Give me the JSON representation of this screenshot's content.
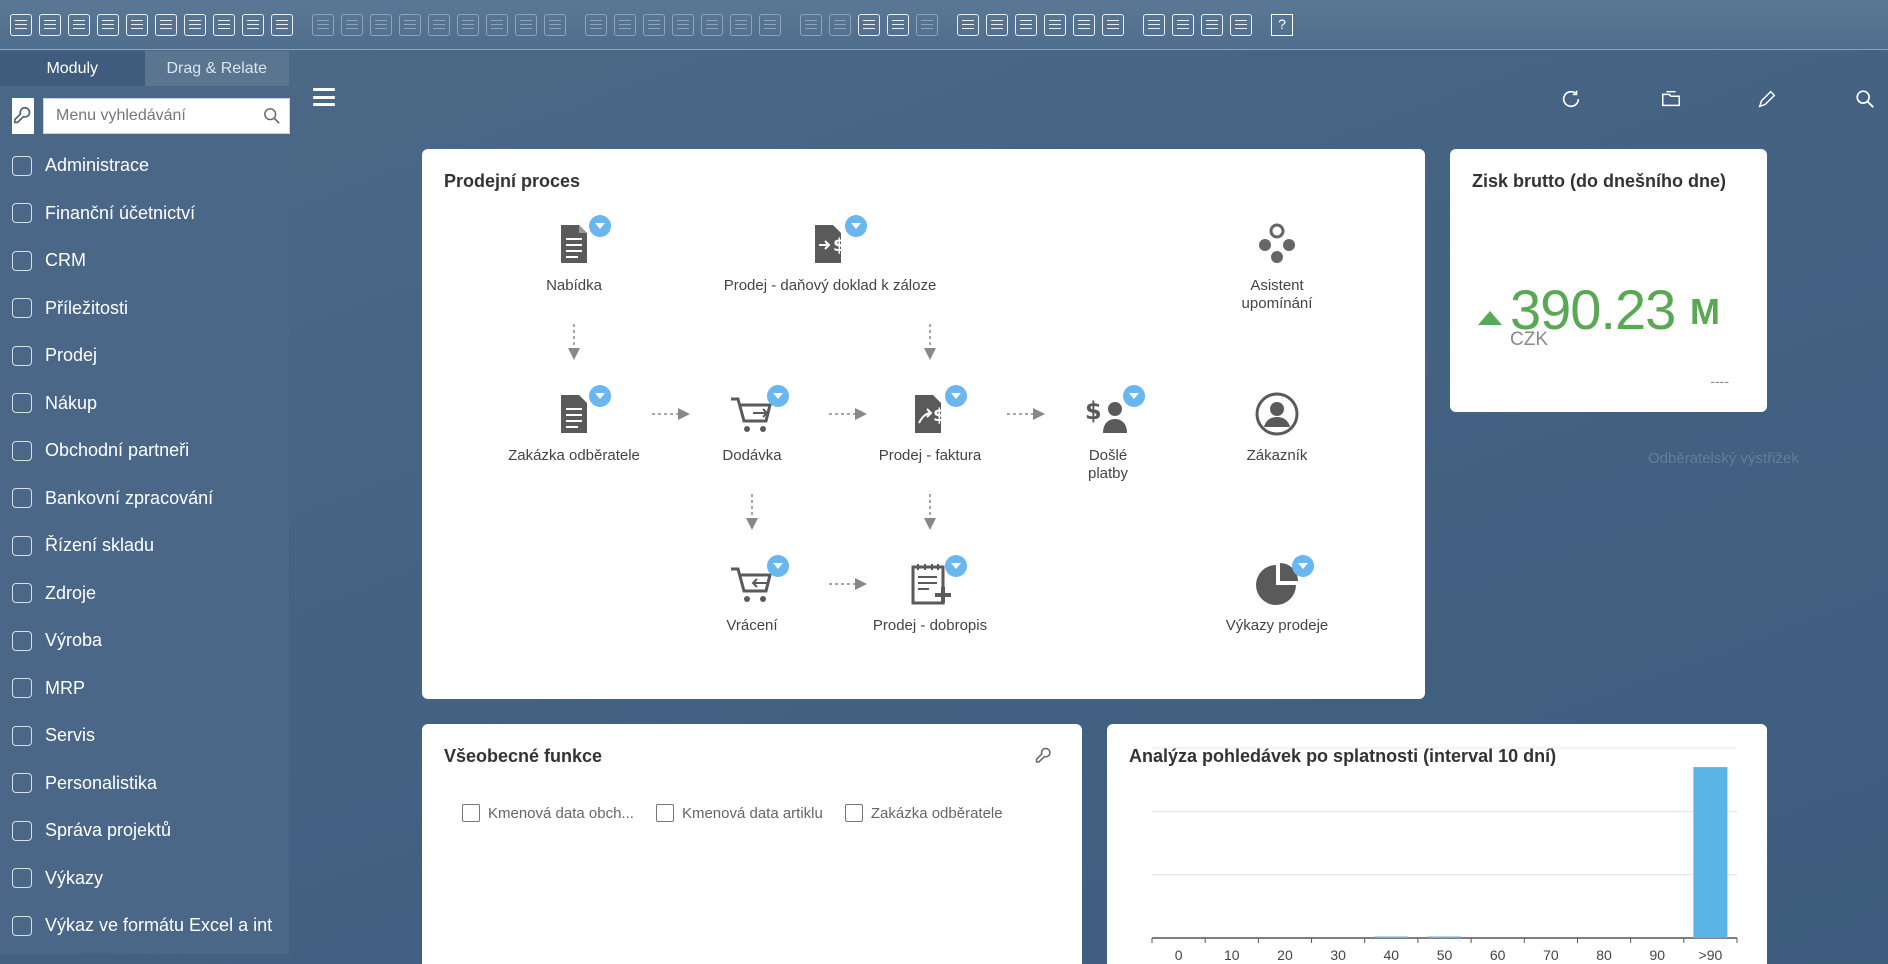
{
  "toolbar": {
    "icons": [
      "preview-icon",
      "print-icon",
      "print-setup-icon",
      "copy-icon",
      "duplicate-icon",
      "excel-icon",
      "word-icon",
      "pdf-icon",
      "move-icon",
      "table-icon",
      "binoculars-icon",
      "goto-icon",
      "first-icon",
      "prev-icon",
      "next-icon",
      "last-icon",
      "swap-icon",
      "filter-icon",
      "select-icon",
      "grid-icon",
      "grid2-icon",
      "calc-icon",
      "coin-icon",
      "scales-icon",
      "document-icon",
      "search-doc-icon",
      "edit-icon",
      "settings-icon",
      "notes-icon",
      "comment-icon",
      "comment2-icon",
      "doc-settings-icon",
      "doc-info-icon",
      "calendar-icon",
      "share-icon",
      "stamp-icon",
      "report-icon",
      "layout-icon",
      "export-icon",
      "approve-icon",
      "web-icon"
    ],
    "help_label": "?"
  },
  "sidebar": {
    "tabs": [
      {
        "label": "Moduly",
        "active": true
      },
      {
        "label": "Drag & Relate",
        "active": false
      }
    ],
    "search_placeholder": "Menu vyhledávání",
    "items": [
      {
        "label": "Administrace",
        "icon": "admin-gear-icon"
      },
      {
        "label": "Finanční účetnictví",
        "icon": "finance-icon"
      },
      {
        "label": "CRM",
        "icon": "crm-icon"
      },
      {
        "label": "Příležitosti",
        "icon": "opportunities-icon"
      },
      {
        "label": "Prodej",
        "icon": "sales-icon"
      },
      {
        "label": "Nákup",
        "icon": "cart-icon"
      },
      {
        "label": "Obchodní partneři",
        "icon": "partners-icon"
      },
      {
        "label": "Bankovní zpracování",
        "icon": "bank-icon"
      },
      {
        "label": "Řízení skladu",
        "icon": "warehouse-icon"
      },
      {
        "label": "Zdroje",
        "icon": "resources-icon"
      },
      {
        "label": "Výroba",
        "icon": "production-icon"
      },
      {
        "label": "MRP",
        "icon": "mrp-icon"
      },
      {
        "label": "Servis",
        "icon": "service-icon"
      },
      {
        "label": "Personalistika",
        "icon": "person-icon"
      },
      {
        "label": "Správa projektů",
        "icon": "projects-icon"
      },
      {
        "label": "Výkazy",
        "icon": "reports-icon"
      },
      {
        "label": "Výkaz ve formátu Excel a int",
        "icon": "excel-report-icon"
      }
    ]
  },
  "sales_process": {
    "title": "Prodejní proces",
    "nodes": {
      "quote": "Nabídka",
      "downpayment": "Prodej - daňový doklad k záloze",
      "reminder": "Asistent upomínání",
      "order": "Zakázka odběratele",
      "delivery": "Dodávka",
      "invoice": "Prodej - faktura",
      "payments": "Došlé platby",
      "customer": "Zákazník",
      "returns": "Vrácení",
      "credit": "Prodej - dobropis",
      "sales_reports": "Výkazy prodeje"
    }
  },
  "kpi": {
    "title": "Zisk brutto (do dnešního dne)",
    "value": "390.23",
    "unit": "M",
    "currency": "CZK",
    "trend_label": "----",
    "accent": "#5aa854"
  },
  "general": {
    "title": "Všeobecné funkce",
    "shortcuts": [
      "Kmenová data obch...",
      "Kmenová data artiklu",
      "Zakázka odběratele"
    ]
  },
  "ghost_item": "Odběratelský výstřižek",
  "chart_data": {
    "type": "bar",
    "title": "Analýza pohledávek po splatnosti (interval 10 dní)",
    "categories": [
      "0",
      "10",
      "20",
      "30",
      "40",
      "50",
      "60",
      "70",
      "80",
      "90",
      ">90"
    ],
    "values": [
      0,
      0,
      0,
      0,
      0.5,
      0.5,
      0,
      0,
      0,
      0,
      100
    ],
    "ylim": [
      0,
      110
    ],
    "color": "#5ab4e6"
  }
}
